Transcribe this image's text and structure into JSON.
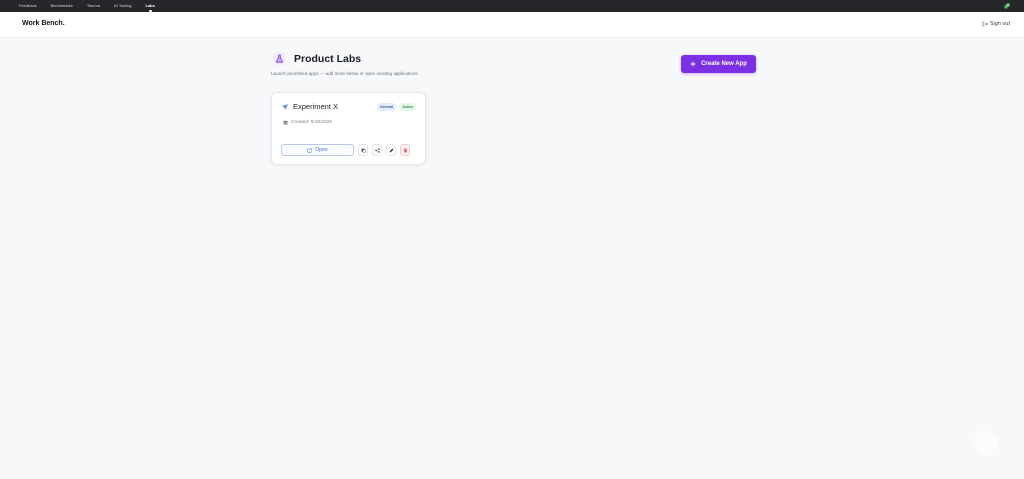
{
  "topbar": {
    "tabs": [
      {
        "label": "Feedback"
      },
      {
        "label": "Benchmarks"
      },
      {
        "label": "Tinerva"
      },
      {
        "label": "AI Tooling"
      },
      {
        "label": "Labs"
      }
    ]
  },
  "header": {
    "brand": "Work Bench.",
    "signout_label": "Sign out"
  },
  "page": {
    "title": "Product Labs",
    "subtitle": "Launch prioritised apps — add more below or open existing applications.",
    "create_button": "Create New App"
  },
  "cards": [
    {
      "title": "Experiment X",
      "badges": [
        "Internal",
        "Active"
      ],
      "created": "Created: 5/19/2025",
      "open_label": "Open"
    }
  ],
  "colors": {
    "accent": "#7c2fe3",
    "topbar": "#25272b",
    "link": "#3b6fc4",
    "danger": "#e04848"
  },
  "icons": [
    "extension-icon",
    "sign-out-icon",
    "flask-icon",
    "plus-icon",
    "rocket-icon",
    "calendar-icon",
    "external-link-icon",
    "copy-icon",
    "share-icon",
    "edit-icon",
    "trash-icon"
  ]
}
